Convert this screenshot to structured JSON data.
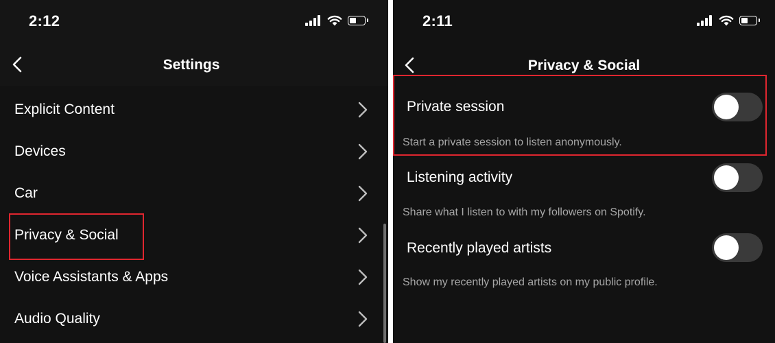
{
  "left_screen": {
    "status_time": "2:12",
    "header_title": "Settings",
    "items": [
      {
        "label": "Explicit Content"
      },
      {
        "label": "Devices"
      },
      {
        "label": "Car"
      },
      {
        "label": "Privacy & Social",
        "highlighted": true
      },
      {
        "label": "Voice Assistants & Apps"
      },
      {
        "label": "Audio Quality"
      }
    ]
  },
  "right_screen": {
    "status_time": "2:11",
    "header_title": "Privacy & Social",
    "settings": [
      {
        "title": "Private session",
        "description": "Start a private session to listen anonymously.",
        "enabled": false,
        "highlighted": true
      },
      {
        "title": "Listening activity",
        "description": "Share what I listen to with my followers on Spotify.",
        "enabled": false
      },
      {
        "title": "Recently played artists",
        "description": "Show my recently played artists on my public profile.",
        "enabled": false
      }
    ]
  },
  "icons": {
    "back": "chevron-left-icon",
    "row": "chevron-right-icon",
    "signal": "cellular-signal-icon",
    "wifi": "wifi-icon",
    "battery": "battery-icon"
  },
  "colors": {
    "background": "#121212",
    "highlight_border": "#e0262f",
    "toggle_off": "#3a3a3a",
    "secondary_text": "#a7a7a7"
  }
}
